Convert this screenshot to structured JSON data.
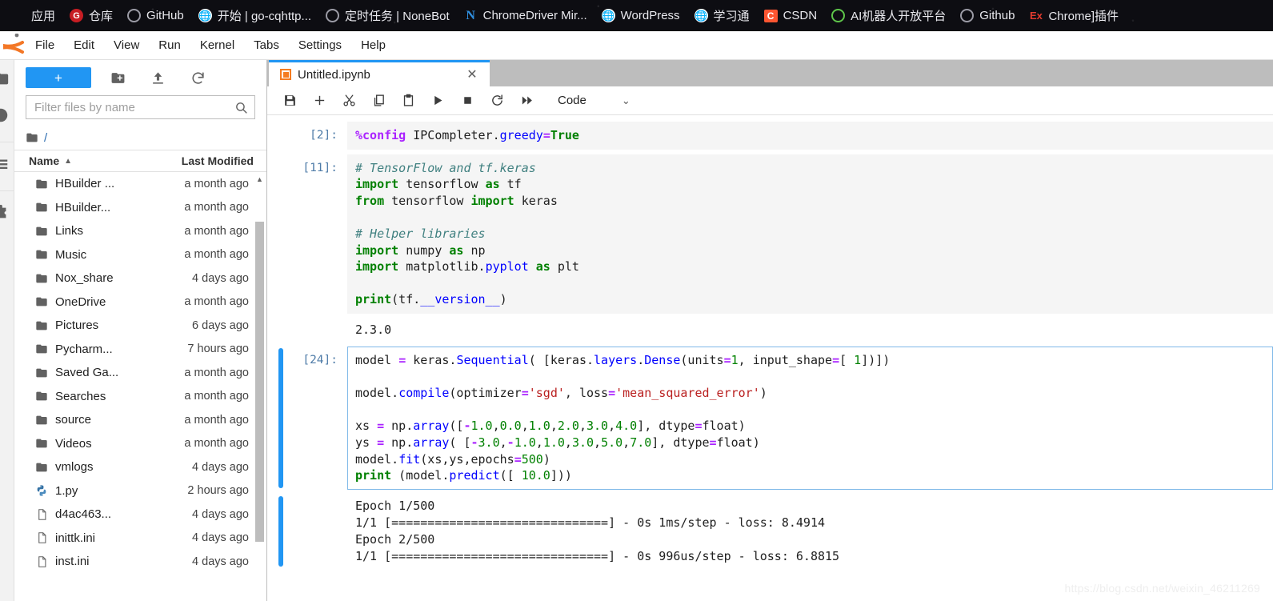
{
  "browser": {
    "bookmarks": [
      {
        "label": "应用",
        "icon": "apps-grid-icon"
      },
      {
        "label": "仓库",
        "icon": "gitee-icon"
      },
      {
        "label": "GitHub",
        "icon": "github-circle-icon"
      },
      {
        "label": "开始 | go-cqhttp...",
        "icon": "globe-icon"
      },
      {
        "label": "定时任务 | NoneBot",
        "icon": "circle-outline-icon"
      },
      {
        "label": "ChromeDriver Mir...",
        "icon": "letter-n-icon"
      },
      {
        "label": "WordPress",
        "icon": "globe-icon"
      },
      {
        "label": "学习通",
        "icon": "globe-icon"
      },
      {
        "label": "CSDN",
        "icon": "letter-c-icon"
      },
      {
        "label": "AI机器人开放平台",
        "icon": "circle-green-icon"
      },
      {
        "label": "Github",
        "icon": "github-circle-icon"
      },
      {
        "label": "Chrome]插件",
        "icon": "letter-ex-icon"
      }
    ]
  },
  "menubar": {
    "logo": "jupyter-logo",
    "items": [
      "File",
      "Edit",
      "View",
      "Run",
      "Kernel",
      "Tabs",
      "Settings",
      "Help"
    ]
  },
  "activitybar": {
    "items": [
      {
        "name": "file-browser-icon"
      },
      {
        "name": "running-terminals-icon"
      },
      {
        "name": "commands-icon"
      },
      {
        "name": "extension-manager-icon"
      }
    ]
  },
  "filebrowser": {
    "new_button_label": "+",
    "tools": [
      {
        "name": "new-folder-icon"
      },
      {
        "name": "upload-icon"
      },
      {
        "name": "refresh-icon"
      }
    ],
    "filter_placeholder": "Filter files by name",
    "filter_value": "",
    "search_icon": "search-icon",
    "breadcrumb": "/",
    "columns": {
      "name": "Name",
      "modified": "Last Modified"
    },
    "sort_direction": "ascending",
    "rows": [
      {
        "icon": "folder-icon",
        "name": "HBuilder ...",
        "modified": "a month ago"
      },
      {
        "icon": "folder-icon",
        "name": "HBuilder...",
        "modified": "a month ago"
      },
      {
        "icon": "folder-icon",
        "name": "Links",
        "modified": "a month ago"
      },
      {
        "icon": "folder-icon",
        "name": "Music",
        "modified": "a month ago"
      },
      {
        "icon": "folder-icon",
        "name": "Nox_share",
        "modified": "4 days ago"
      },
      {
        "icon": "folder-icon",
        "name": "OneDrive",
        "modified": "a month ago"
      },
      {
        "icon": "folder-icon",
        "name": "Pictures",
        "modified": "6 days ago"
      },
      {
        "icon": "folder-icon",
        "name": "Pycharm...",
        "modified": "7 hours ago"
      },
      {
        "icon": "folder-icon",
        "name": "Saved Ga...",
        "modified": "a month ago"
      },
      {
        "icon": "folder-icon",
        "name": "Searches",
        "modified": "a month ago"
      },
      {
        "icon": "folder-icon",
        "name": "source",
        "modified": "a month ago"
      },
      {
        "icon": "folder-icon",
        "name": "Videos",
        "modified": "a month ago"
      },
      {
        "icon": "folder-icon",
        "name": "vmlogs",
        "modified": "4 days ago"
      },
      {
        "icon": "python-file-icon",
        "name": "1.py",
        "modified": "2 hours ago"
      },
      {
        "icon": "text-file-icon",
        "name": "d4ac463...",
        "modified": "4 days ago"
      },
      {
        "icon": "text-file-icon",
        "name": "inittk.ini",
        "modified": "4 days ago"
      },
      {
        "icon": "text-file-icon",
        "name": "inst.ini",
        "modified": "4 days ago"
      }
    ]
  },
  "notebook": {
    "tab": {
      "title": "Untitled.ipynb",
      "icon": "notebook-icon",
      "close_icon": "close-icon"
    },
    "toolbar": {
      "buttons": [
        {
          "name": "save-icon"
        },
        {
          "name": "insert-cell-icon"
        },
        {
          "name": "cut-icon"
        },
        {
          "name": "copy-icon"
        },
        {
          "name": "paste-icon"
        },
        {
          "name": "run-icon"
        },
        {
          "name": "stop-icon"
        },
        {
          "name": "restart-kernel-icon"
        },
        {
          "name": "restart-run-all-icon"
        }
      ],
      "celltype_value": "Code",
      "celltype_chevron": "chevron-down-icon"
    },
    "cells": [
      {
        "prompt": "[2]:",
        "active": false,
        "type": "code",
        "source": "%config IPCompleter.greedy=True"
      },
      {
        "prompt": "[11]:",
        "active": false,
        "type": "code",
        "source": "# TensorFlow and tf.keras\nimport tensorflow as tf\nfrom tensorflow import keras\n\n# Helper libraries\nimport numpy as np\nimport matplotlib.pyplot as plt\n\nprint(tf.__version__)"
      },
      {
        "prompt": "",
        "active": false,
        "type": "output",
        "source": "2.3.0"
      },
      {
        "prompt": "[24]:",
        "active": true,
        "type": "code",
        "source": "model = keras.Sequential( [keras.layers.Dense(units=1, input_shape=[ 1])])\n\nmodel.compile(optimizer='sgd', loss='mean_squared_error')\n\nxs = np.array([-1.0,0.0,1.0,2.0,3.0,4.0], dtype=float)\nys = np.array( [-3.0,-1.0,1.0,3.0,5.0,7.0], dtype=float)\nmodel.fit(xs,ys,epochs=500)\nprint (model.predict([ 10.0]))"
      },
      {
        "prompt": "",
        "active": true,
        "type": "output",
        "source": "Epoch 1/500\n1/1 [==============================] - 0s 1ms/step - loss: 8.4914\nEpoch 2/500\n1/1 [==============================] - 0s 996us/step - loss: 6.8815"
      }
    ]
  },
  "watermark": "https://blog.csdn.net/weixin_46211269",
  "colors": {
    "accent_blue": "#2196f3",
    "tabbar_gray": "#bdbdbd",
    "cell_bg": "#f5f5f5",
    "bookmark_bar_bg": "#0d0d12"
  }
}
